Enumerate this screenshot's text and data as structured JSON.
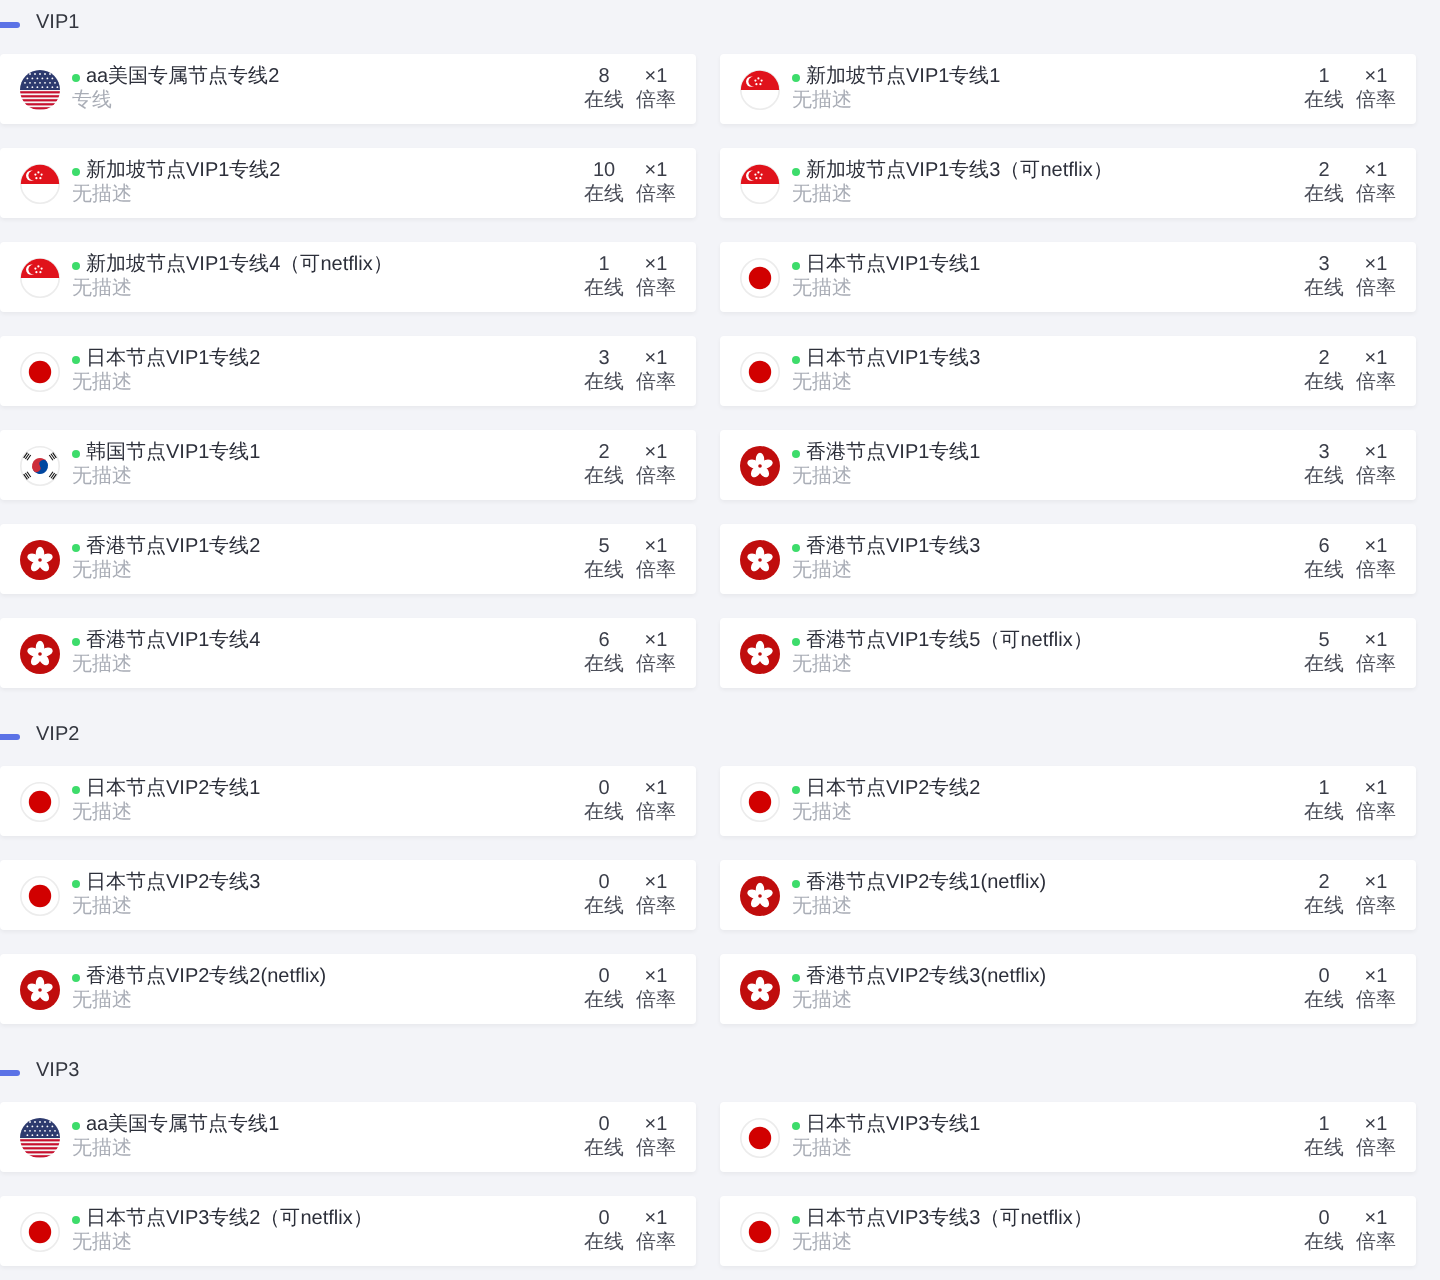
{
  "sections": [
    {
      "title": "VIP1",
      "nodes": [
        {
          "kind": "us",
          "online": true,
          "name": "aa美国专属节点专线2",
          "description": "专线",
          "users": "8",
          "users_label": "在线",
          "rate": "×1",
          "rate_label": "倍率"
        },
        {
          "kind": "singapore",
          "online": true,
          "name": "新加坡节点VIP1专线1",
          "description": "无描述",
          "users": "1",
          "users_label": "在线",
          "rate": "×1",
          "rate_label": "倍率"
        },
        {
          "kind": "singapore",
          "online": true,
          "name": "新加坡节点VIP1专线2",
          "description": "无描述",
          "users": "10",
          "users_label": "在线",
          "rate": "×1",
          "rate_label": "倍率"
        },
        {
          "kind": "singapore",
          "online": true,
          "name": "新加坡节点VIP1专线3（可netflix）",
          "description": "无描述",
          "users": "2",
          "users_label": "在线",
          "rate": "×1",
          "rate_label": "倍率"
        },
        {
          "kind": "singapore",
          "online": true,
          "name": "新加坡节点VIP1专线4（可netflix）",
          "description": "无描述",
          "users": "1",
          "users_label": "在线",
          "rate": "×1",
          "rate_label": "倍率"
        },
        {
          "kind": "japan",
          "online": true,
          "name": "日本节点VIP1专线1",
          "description": "无描述",
          "users": "3",
          "users_label": "在线",
          "rate": "×1",
          "rate_label": "倍率"
        },
        {
          "kind": "japan",
          "online": true,
          "name": "日本节点VIP1专线2",
          "description": "无描述",
          "users": "3",
          "users_label": "在线",
          "rate": "×1",
          "rate_label": "倍率"
        },
        {
          "kind": "japan",
          "online": true,
          "name": "日本节点VIP1专线3",
          "description": "无描述",
          "users": "2",
          "users_label": "在线",
          "rate": "×1",
          "rate_label": "倍率"
        },
        {
          "kind": "korea",
          "online": true,
          "name": "韩国节点VIP1专线1",
          "description": "无描述",
          "users": "2",
          "users_label": "在线",
          "rate": "×1",
          "rate_label": "倍率"
        },
        {
          "kind": "hongkong",
          "online": true,
          "name": "香港节点VIP1专线1",
          "description": "无描述",
          "users": "3",
          "users_label": "在线",
          "rate": "×1",
          "rate_label": "倍率"
        },
        {
          "kind": "hongkong",
          "online": true,
          "name": "香港节点VIP1专线2",
          "description": "无描述",
          "users": "5",
          "users_label": "在线",
          "rate": "×1",
          "rate_label": "倍率"
        },
        {
          "kind": "hongkong",
          "online": true,
          "name": "香港节点VIP1专线3",
          "description": "无描述",
          "users": "6",
          "users_label": "在线",
          "rate": "×1",
          "rate_label": "倍率"
        },
        {
          "kind": "hongkong",
          "online": true,
          "name": "香港节点VIP1专线4",
          "description": "无描述",
          "users": "6",
          "users_label": "在线",
          "rate": "×1",
          "rate_label": "倍率"
        },
        {
          "kind": "hongkong",
          "online": true,
          "name": "香港节点VIP1专线5（可netflix）",
          "description": "无描述",
          "users": "5",
          "users_label": "在线",
          "rate": "×1",
          "rate_label": "倍率"
        }
      ]
    },
    {
      "title": "VIP2",
      "nodes": [
        {
          "kind": "japan",
          "online": true,
          "name": "日本节点VIP2专线1",
          "description": "无描述",
          "users": "0",
          "users_label": "在线",
          "rate": "×1",
          "rate_label": "倍率"
        },
        {
          "kind": "japan",
          "online": true,
          "name": "日本节点VIP2专线2",
          "description": "无描述",
          "users": "1",
          "users_label": "在线",
          "rate": "×1",
          "rate_label": "倍率"
        },
        {
          "kind": "japan",
          "online": true,
          "name": "日本节点VIP2专线3",
          "description": "无描述",
          "users": "0",
          "users_label": "在线",
          "rate": "×1",
          "rate_label": "倍率"
        },
        {
          "kind": "hongkong",
          "online": true,
          "name": "香港节点VIP2专线1(netflix)",
          "description": "无描述",
          "users": "2",
          "users_label": "在线",
          "rate": "×1",
          "rate_label": "倍率"
        },
        {
          "kind": "hongkong",
          "online": true,
          "name": "香港节点VIP2专线2(netflix)",
          "description": "无描述",
          "users": "0",
          "users_label": "在线",
          "rate": "×1",
          "rate_label": "倍率"
        },
        {
          "kind": "hongkong",
          "online": true,
          "name": "香港节点VIP2专线3(netflix)",
          "description": "无描述",
          "users": "0",
          "users_label": "在线",
          "rate": "×1",
          "rate_label": "倍率"
        }
      ]
    },
    {
      "title": "VIP3",
      "nodes": [
        {
          "kind": "us",
          "online": true,
          "name": "aa美国专属节点专线1",
          "description": "无描述",
          "users": "0",
          "users_label": "在线",
          "rate": "×1",
          "rate_label": "倍率"
        },
        {
          "kind": "japan",
          "online": true,
          "name": "日本节点VIP3专线1",
          "description": "无描述",
          "users": "1",
          "users_label": "在线",
          "rate": "×1",
          "rate_label": "倍率"
        },
        {
          "kind": "japan",
          "online": true,
          "name": "日本节点VIP3专线2（可netflix）",
          "description": "无描述",
          "users": "0",
          "users_label": "在线",
          "rate": "×1",
          "rate_label": "倍率"
        },
        {
          "kind": "japan",
          "online": true,
          "name": "日本节点VIP3专线3（可netflix）",
          "description": "无描述",
          "users": "0",
          "users_label": "在线",
          "rate": "×1",
          "rate_label": "倍率"
        }
      ]
    }
  ]
}
